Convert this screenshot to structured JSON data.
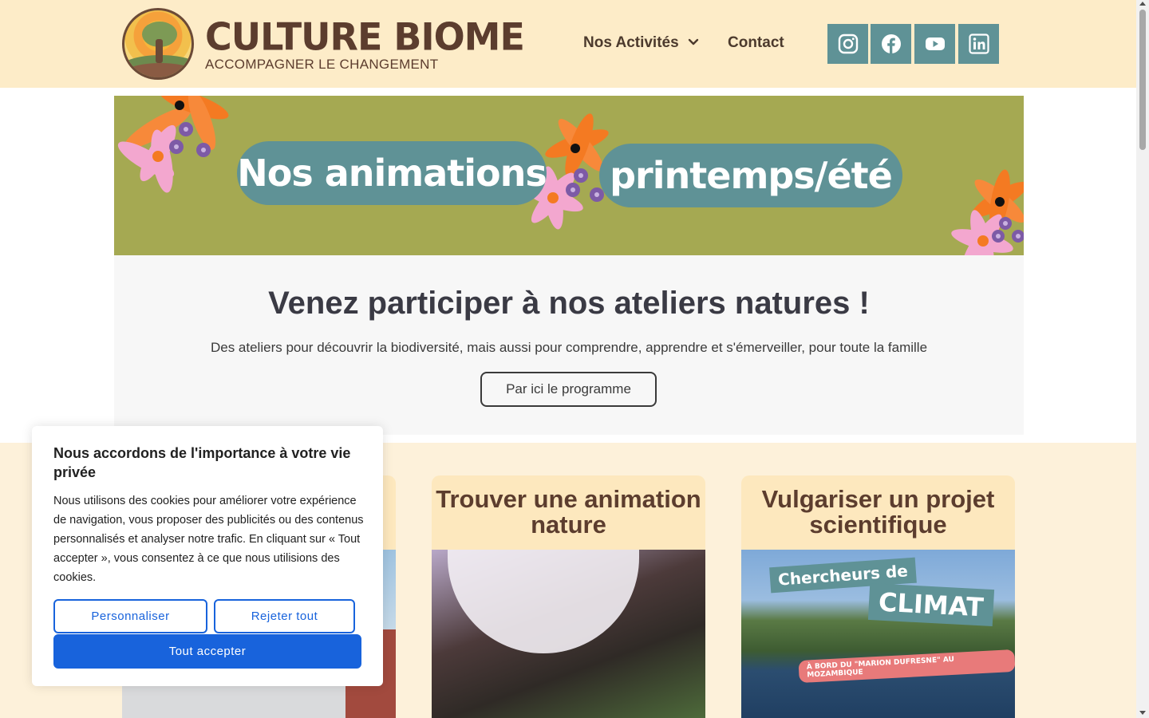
{
  "header": {
    "brand_title": "CULTURE BIOME",
    "brand_subtitle": "ACCOMPAGNER LE CHANGEMENT",
    "nav": {
      "activities_label": "Nos Activités",
      "contact_label": "Contact"
    },
    "social": [
      "instagram-icon",
      "facebook-icon",
      "youtube-icon",
      "linkedin-icon"
    ]
  },
  "banner": {
    "pill_left": "Nos animations",
    "pill_right": "printemps/été"
  },
  "intro": {
    "title": "Venez participer à nos ateliers natures !",
    "description": "Des ateliers pour découvrir la biodiversité, mais aussi pour comprendre, apprendre et s'émerveiller, pour toute la famille",
    "button_label": "Par ici le programme"
  },
  "cards": [
    {
      "title": ""
    },
    {
      "title": "Trouver une animation nature"
    },
    {
      "title": "Vulgariser un projet scientifique",
      "image_text": {
        "line1": "Chercheurs de",
        "line2": "CLIMAT",
        "line3": "À BORD DU \"MARION DUFRESNE\" AU MOZAMBIQUE"
      }
    }
  ],
  "cookie": {
    "title": "Nous accordons de l'importance à votre vie privée",
    "text": "Nous utilisons des cookies pour améliorer votre expérience de navigation, vous proposer des publicités ou des contenus personnalisés et analyser notre trafic. En cliquant sur « Tout accepter », vous consentez à ce que nous utilisions des cookies.",
    "customize_label": "Personnaliser",
    "reject_label": "Rejeter tout",
    "accept_label": "Tout accepter"
  },
  "colors": {
    "header_bg": "#fdecc8",
    "brand": "#5c3d2e",
    "teal": "#5f9296",
    "banner_bg": "#a5a952",
    "cookie_accent": "#1863dc"
  }
}
